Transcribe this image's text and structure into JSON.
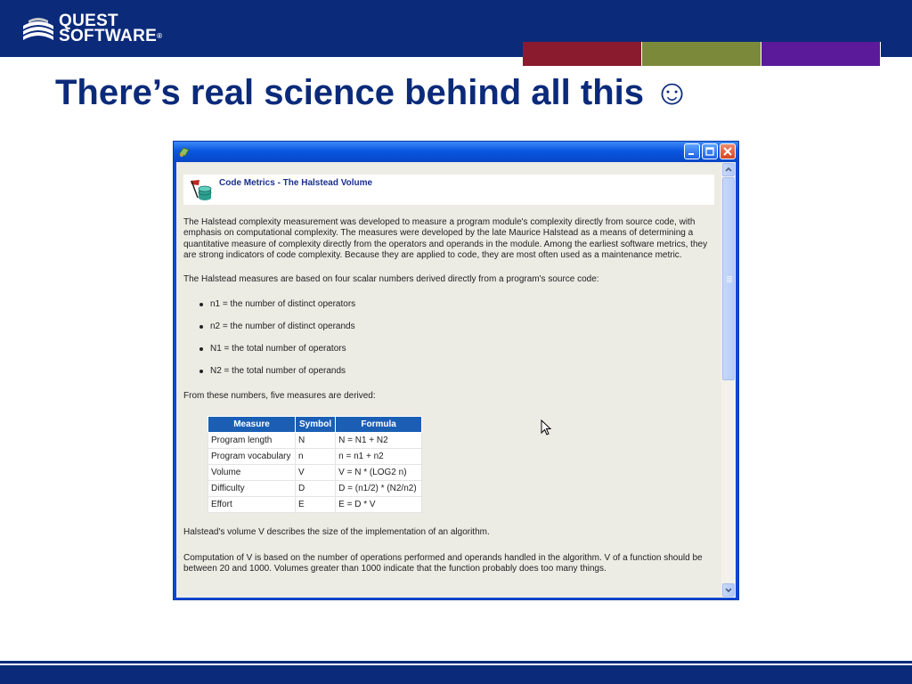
{
  "brand": {
    "line1": "QUEST",
    "line2": "SOFTWARE",
    "registered_mark": "®",
    "colors": {
      "primary_blue": "#0b2a7a",
      "accent_red": "#8a1a2e",
      "accent_olive": "#7b8a3a",
      "accent_purple": "#5b1a9a"
    }
  },
  "slide": {
    "title": "There’s real science behind all this ☺"
  },
  "window": {
    "title": "",
    "controls": [
      "minimize",
      "maximize",
      "close"
    ],
    "title_bar_color": "#0a57e1"
  },
  "document": {
    "header_title": "Code Metrics - The Halstead Volume",
    "intro": "The Halstead complexity measurement was developed to measure a program module's complexity directly from source code, with emphasis on computational complexity. The measures were developed by the late Maurice Halstead as a means of determining a quantitative measure of complexity directly from the operators and operands in the module. Among the earliest software metrics, they are strong indicators of code complexity. Because they are applied to code, they are most often used as a maintenance metric.",
    "measures_intro": "The Halstead measures are based on four scalar numbers derived directly from a program's source code:",
    "bullets": [
      "n1 = the number of distinct operators",
      "n2 = the number of distinct operands",
      "N1 = the total number of operators",
      "N2 = the total number of operands"
    ],
    "derived_intro": "From these numbers, five measures are derived:",
    "table": {
      "headers": [
        "Measure",
        "Symbol",
        "Formula"
      ],
      "rows": [
        [
          "Program length",
          "N",
          "N = N1 + N2"
        ],
        [
          "Program vocabulary",
          "n",
          "n = n1 + n2"
        ],
        [
          "Volume",
          "V",
          "V = N * (LOG2 n)"
        ],
        [
          "Difficulty",
          "D",
          "D = (n1/2) * (N2/n2)"
        ],
        [
          "Effort",
          "E",
          "E = D * V"
        ]
      ]
    },
    "volume_desc": "Halstead's volume V describes the size of the implementation of an algorithm.",
    "computation_desc": "Computation of V is based on the number of operations performed and operands handled in the algorithm. V of a function should be between 20 and 1000. Volumes greater than 1000 indicate that the function probably does too many things."
  }
}
